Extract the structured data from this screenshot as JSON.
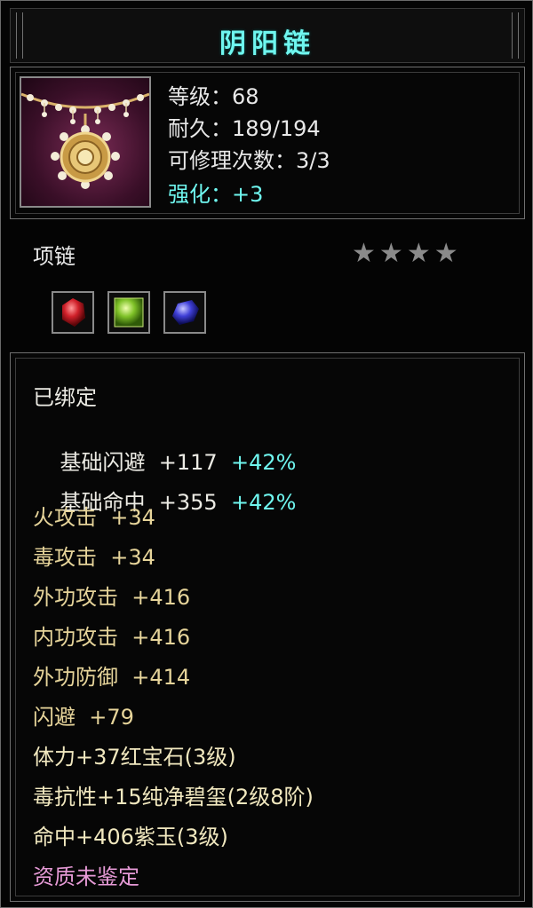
{
  "item": {
    "name": "阴阳链",
    "level_label": "等级：68",
    "durability_label": "耐久：189/194",
    "repair_label": "可修理次数：3/3",
    "enhance_label": "强化：+3",
    "type": "项链",
    "stars_filled": 0,
    "stars_total": 4
  },
  "gems": [
    {
      "name": "ruby-gem-icon",
      "color": "#c01a22"
    },
    {
      "name": "jade-gem-icon",
      "color": "#6bb52a"
    },
    {
      "name": "sapphire-gem-icon",
      "color": "#3a3ad0"
    }
  ],
  "attributes": {
    "bound": "已绑定",
    "dodge_base": "基础闪避",
    "dodge_value": "+117",
    "dodge_pct": "+42%",
    "hit_base": "基础命中",
    "hit_value": "+355",
    "hit_pct": "+42%",
    "fire_atk": "火攻击  +34",
    "poison_atk": "毒攻击  +34",
    "ext_atk": "外功攻击  +416",
    "int_atk": "内功攻击  +416",
    "ext_def": "外功防御  +414",
    "dodge": "闪避  +79",
    "gem1": "体力+37红宝石(3级)",
    "gem2": "毒抗性+15纯净碧玺(2级8阶)",
    "gem3": "命中+406紫玉(3级)",
    "quality": "资质未鉴定"
  },
  "colors": {
    "title": "#6ff6ef",
    "white": "#ecebe4",
    "gold": "#e6d49a",
    "pink": "#e69ad6"
  }
}
